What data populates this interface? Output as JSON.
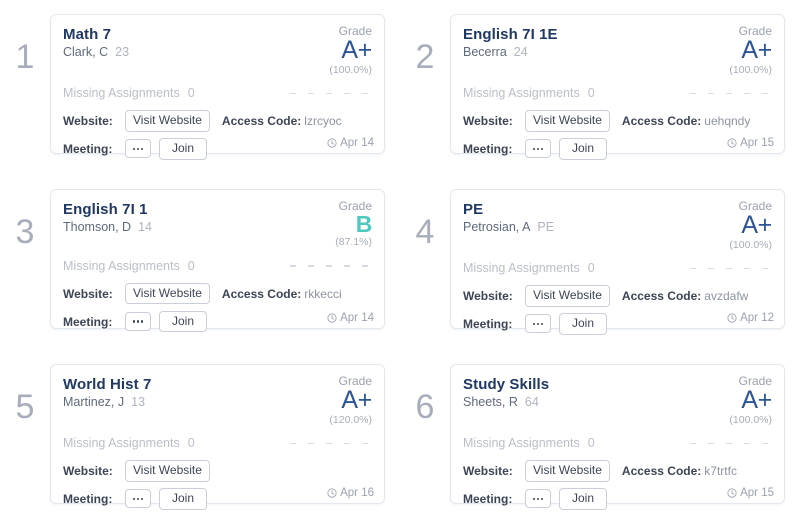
{
  "colors": {
    "course_title": "#1f3864",
    "grade_default": "#2d5596",
    "grade_b": "#4ec9c0",
    "muted": "#b9bfc9",
    "card_border": "#e3e7ee",
    "index_number": "#a7adba"
  },
  "labels": {
    "grade": "Grade",
    "missing_assignments": "Missing Assignments",
    "website": "Website:",
    "meeting": "Meeting:",
    "visit_website": "Visit Website",
    "join": "Join",
    "access_code_label": "Access Code:",
    "dots": "•••"
  },
  "cards": [
    {
      "index": "1",
      "course": "Math 7",
      "teacher": "Clark, C",
      "period": "23",
      "grade_letter": "A+",
      "grade_percent": "(100.0%)",
      "grade_color": "#2d5596",
      "missing_count": "0",
      "dash_count": 5,
      "website_button": "Visit Website",
      "access_code": "lzrcyoc",
      "meeting_join": "Join",
      "date": "Apr 14"
    },
    {
      "index": "2",
      "course": "English 7I 1E",
      "teacher": "Becerra",
      "period": "24",
      "grade_letter": "A+",
      "grade_percent": "(100.0%)",
      "grade_color": "#2d5596",
      "missing_count": "0",
      "dash_count": 5,
      "website_button": "Visit Website",
      "access_code": "uehqndy",
      "meeting_join": "Join",
      "date": "Apr 15"
    },
    {
      "index": "3",
      "course": "English 7I 1",
      "teacher": "Thomson, D",
      "period": "14",
      "grade_letter": "B",
      "grade_percent": "(87.1%)",
      "grade_color": "#4ec9c0",
      "missing_count": "0",
      "dash_count": 5,
      "website_button": "Visit Website",
      "access_code": "rkkecci",
      "meeting_join": "Join",
      "date": "Apr 14"
    },
    {
      "index": "4",
      "course": "PE",
      "teacher": "Petrosian, A",
      "period": "PE",
      "grade_letter": "A+",
      "grade_percent": "(100.0%)",
      "grade_color": "#2d5596",
      "missing_count": "0",
      "dash_count": 5,
      "website_button": "Visit Website",
      "access_code": "avzdafw",
      "meeting_join": "Join",
      "date": "Apr 12"
    },
    {
      "index": "5",
      "course": "World Hist 7",
      "teacher": "Martinez, J",
      "period": "13",
      "grade_letter": "A+",
      "grade_percent": "(120.0%)",
      "grade_color": "#2d5596",
      "missing_count": "0",
      "dash_count": 5,
      "website_button": "Visit Website",
      "access_code": "",
      "meeting_join": "Join",
      "date": "Apr 16"
    },
    {
      "index": "6",
      "course": "Study Skills",
      "teacher": "Sheets, R",
      "period": "64",
      "grade_letter": "A+",
      "grade_percent": "(100.0%)",
      "grade_color": "#2d5596",
      "missing_count": "0",
      "dash_count": 5,
      "website_button": "Visit Website",
      "access_code": "k7trtfc",
      "meeting_join": "Join",
      "date": "Apr 15"
    }
  ]
}
